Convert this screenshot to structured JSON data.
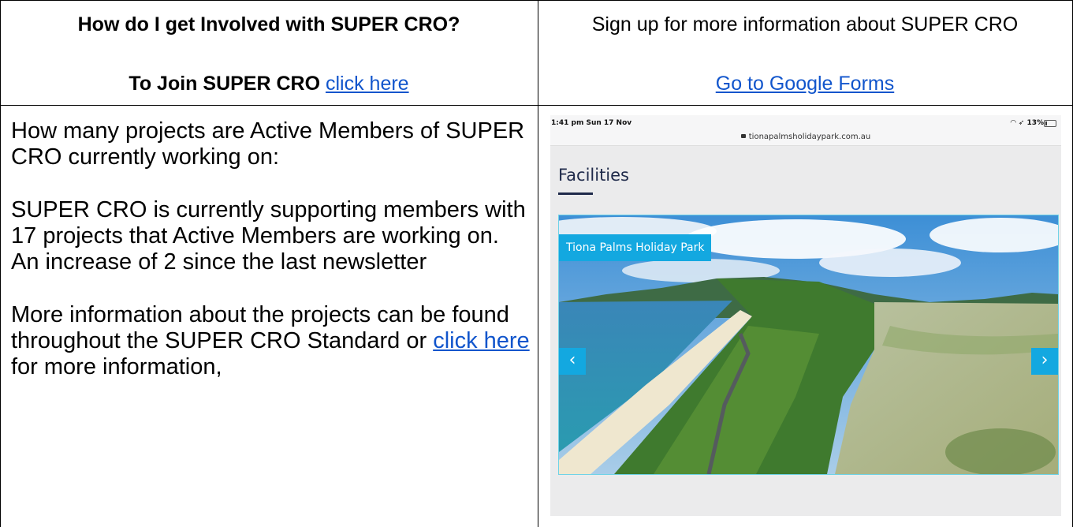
{
  "row1": {
    "left": {
      "heading": "How do I get Involved with SUPER CRO?",
      "join_prefix": "To Join SUPER CRO",
      "join_link": "click here"
    },
    "right": {
      "text": "Sign up for more information about SUPER CRO",
      "link": "Go to Google Forms"
    }
  },
  "row2": {
    "left": {
      "p1": "How many projects are Active Members of SUPER CRO currently working on:",
      "p2": "SUPER CRO is currently supporting members with 17 projects that Active Members are working on. An increase of 2 since the last newsletter",
      "p3_prefix": "More information about the projects can be found throughout the SUPER CRO Standard or",
      "p3_link": "click here",
      "p3_suffix": "for more information,"
    },
    "screenshot": {
      "status_time": "1:41 pm  Sun 17 Nov",
      "status_right": "13%",
      "url": "tionapalmsholidaypark.com.au",
      "title": "Facilities",
      "badge": "Tiona Palms Holiday Park",
      "prev_arrow": "‹",
      "next_arrow": "›"
    }
  }
}
